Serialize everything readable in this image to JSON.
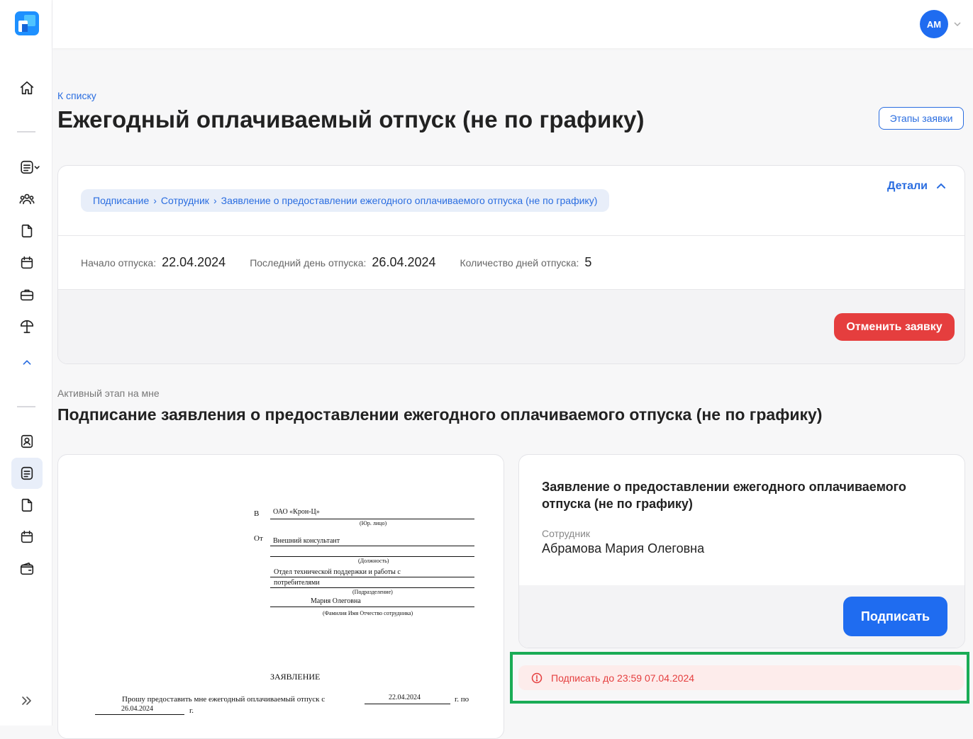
{
  "app": {
    "user_initials": "АМ"
  },
  "sidebar": {
    "items": [
      {
        "name": "home-icon"
      },
      {
        "name": "document-list-icon"
      },
      {
        "name": "team-icon"
      },
      {
        "name": "file-icon"
      },
      {
        "name": "calendar-icon"
      },
      {
        "name": "briefcase-icon"
      },
      {
        "name": "vacation-umbrella-icon"
      },
      {
        "name": "chevron-up-icon"
      },
      {
        "name": "profile-card-icon"
      },
      {
        "name": "requests-icon"
      },
      {
        "name": "file-icon"
      },
      {
        "name": "calendar-icon"
      },
      {
        "name": "wallet-icon"
      }
    ]
  },
  "header": {
    "back_link": "К списку",
    "title": "Ежегодный оплачиваемый отпуск (не по графику)",
    "stages_button": "Этапы заявки"
  },
  "summary": {
    "breadcrumbs": [
      "Подписание",
      "Сотрудник",
      "Заявление о предоставлении ежегодного оплачиваемого отпуска (не по графику)"
    ],
    "breadcrumb_separator": "›",
    "details_label": "Детали",
    "fields": [
      {
        "label": "Начало отпуска:",
        "value": "22.04.2024"
      },
      {
        "label": "Последний день отпуска:",
        "value": "26.04.2024"
      },
      {
        "label": "Количество дней отпуска:",
        "value": "5"
      }
    ],
    "cancel_button": "Отменить заявку"
  },
  "stage": {
    "active_label": "Активный этап на мне",
    "title": "Подписание заявления о предоставлении ежегодного оплачиваемого отпуска (не по графику)"
  },
  "document_preview": {
    "to_prefix": "В",
    "org": "ОАО «Крон-Ц»",
    "org_caption": "(Юр. лицо)",
    "from_prefix": "От",
    "position": "Внешний консультант",
    "position_caption": "(Должность)",
    "department_line1": "Отдел технической поддержки и работы с",
    "department_line2": "потребителями",
    "department_caption": "(Подразделение)",
    "employee_short": "Мария Олеговна",
    "employee_caption": "(Фамилия Имя Отчество сотрудника)",
    "heading": "ЗАЯВЛЕНИЕ",
    "body_text": "Прошу предоставить мне ежегодный оплачиваемый отпуск с",
    "date_from": "22.04.2024",
    "year_to": "г. по",
    "date_to": "26.04.2024",
    "year_suffix": "г."
  },
  "sign_panel": {
    "title": "Заявление о предоставлении ежегодного оплачиваемого отпуска (не по графику)",
    "employee_label": "Сотрудник",
    "employee_name": "Абрамова Мария Олеговна",
    "sign_button": "Подписать",
    "deadline": "Подписать до 23:59 07.04.2024"
  },
  "colors": {
    "accent": "#1f6cf0",
    "danger": "#e53e3e",
    "highlight": "#1aac56"
  }
}
